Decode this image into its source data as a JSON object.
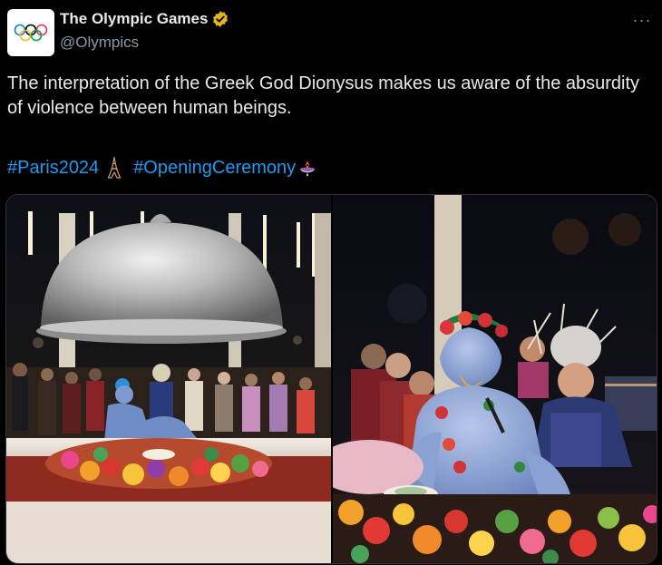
{
  "author": {
    "display_name": "The Olympic Games",
    "handle": "@Olympics",
    "verified": true,
    "verified_color": "#e2b719",
    "avatar_icon": "olympic-rings-icon"
  },
  "menu": {
    "more_label": "···"
  },
  "tweet": {
    "text": "The interpretation of the Greek God Dionysus makes us aware of the absurdity of violence between human beings.",
    "hashtags": [
      "#Paris2024",
      "#OpeningCeremony"
    ],
    "emojis": [
      "eiffel-tower-emoji",
      "olympic-cauldron-emoji"
    ]
  },
  "media": {
    "images": [
      {
        "name": "banquet-table-with-silver-dome-photo"
      },
      {
        "name": "blue-dionysus-performer-closeup-photo"
      }
    ]
  },
  "colors": {
    "background": "#000000",
    "text": "#e7e9ea",
    "secondary": "#8b98a5",
    "link": "#1d9bf0",
    "border": "#2f3336"
  }
}
